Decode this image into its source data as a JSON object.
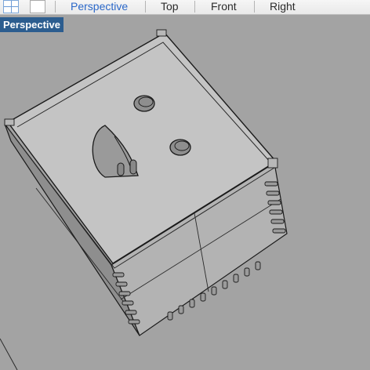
{
  "toolbar": {
    "layout_grid_icon": "four-viewports-icon",
    "layout_single_icon": "single-viewport-icon",
    "tabs": [
      "Perspective",
      "Top",
      "Front",
      "Right"
    ],
    "active_tab": "Perspective"
  },
  "viewport": {
    "label": "Perspective",
    "background_color": "#a3a3a3",
    "object": "box-model",
    "object_face_color": "#c3c3c3",
    "edge_color": "#1a1a1a"
  }
}
